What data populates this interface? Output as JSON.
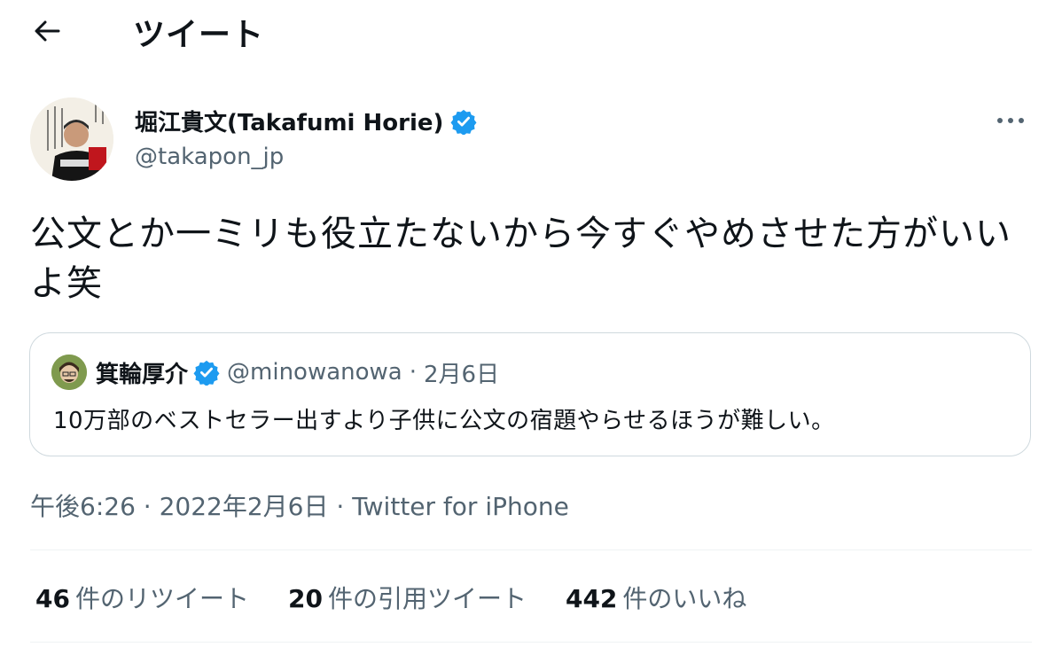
{
  "header": {
    "title": "ツイート",
    "back_icon": "arrow-left-icon"
  },
  "tweet": {
    "author": {
      "name": "堀江貴文(Takafumi Horie)",
      "handle": "@takapon_jp",
      "verified": true
    },
    "text": "公文とか一ミリも役立たないから今すぐやめさせた方がいいよ笑",
    "more_icon": "more-horizontal-icon",
    "meta": {
      "time": "午後6:26",
      "separator1": " · ",
      "date": "2022年2月6日",
      "separator2": " · ",
      "source": "Twitter for iPhone"
    }
  },
  "quoted": {
    "name": "箕輪厚介",
    "verified": true,
    "handle": "@minowanowa",
    "separator": "·",
    "date": "2月6日",
    "text": "10万部のベストセラー出すより子供に公文の宿題やらせるほうが難しい。"
  },
  "stats": [
    {
      "count": "46",
      "label": "件のリツイート"
    },
    {
      "count": "20",
      "label": "件の引用ツイート"
    },
    {
      "count": "442",
      "label": "件のいいね"
    }
  ],
  "colors": {
    "verified_blue": "#1d9bf0",
    "secondary_text": "#536471",
    "border": "#cfd9de"
  }
}
